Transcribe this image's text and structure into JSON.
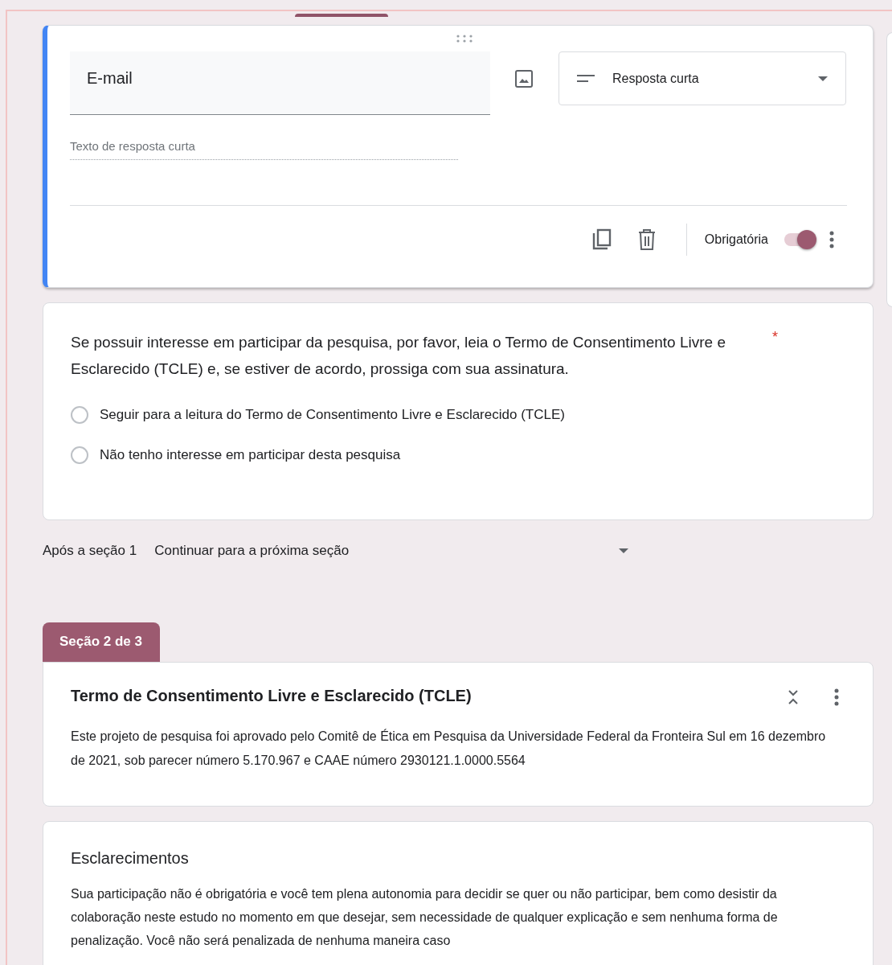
{
  "question_card": {
    "active": true,
    "title": "E-mail",
    "type_select": "Resposta curta",
    "placeholder": "Texto de resposta curta",
    "required_label": "Obrigatória",
    "required": true
  },
  "choice_card": {
    "question": "Se possuir interesse em participar da pesquisa, por favor, leia o Termo de Consentimento Livre e Esclarecido (TCLE) e, se estiver de acordo, prossiga com sua assinatura.",
    "required_mark": "*",
    "options": [
      {
        "label": "Seguir para a leitura do Termo de Consentimento Livre e Esclarecido (TCLE)",
        "selected": false
      },
      {
        "label": "Não tenho interesse em participar desta pesquisa",
        "selected": false
      }
    ]
  },
  "after_section": {
    "label": "Após a seção 1",
    "value": "Continuar para a próxima seção"
  },
  "section_tab": "Seção 2 de 3",
  "section_header": {
    "title": "Termo de Consentimento Livre e Esclarecido (TCLE)",
    "description": "Este projeto de pesquisa foi aprovado pelo Comitê de Ética em Pesquisa da Universidade Federal da Fronteira Sul em 16 dezembro de 2021, sob parecer número 5.170.967 e CAAE número 2930121.1.0000.5564"
  },
  "text_card": {
    "title": "Esclarecimentos",
    "body": "Sua participação não é obrigatória e você tem plena autonomia para decidir se quer ou não participar, bem como desistir da colaboração neste estudo no momento em que desejar, sem necessidade de qualquer explicação e sem nenhuma forma de penalização. Você não será penalizada de nenhuma maneira caso"
  }
}
